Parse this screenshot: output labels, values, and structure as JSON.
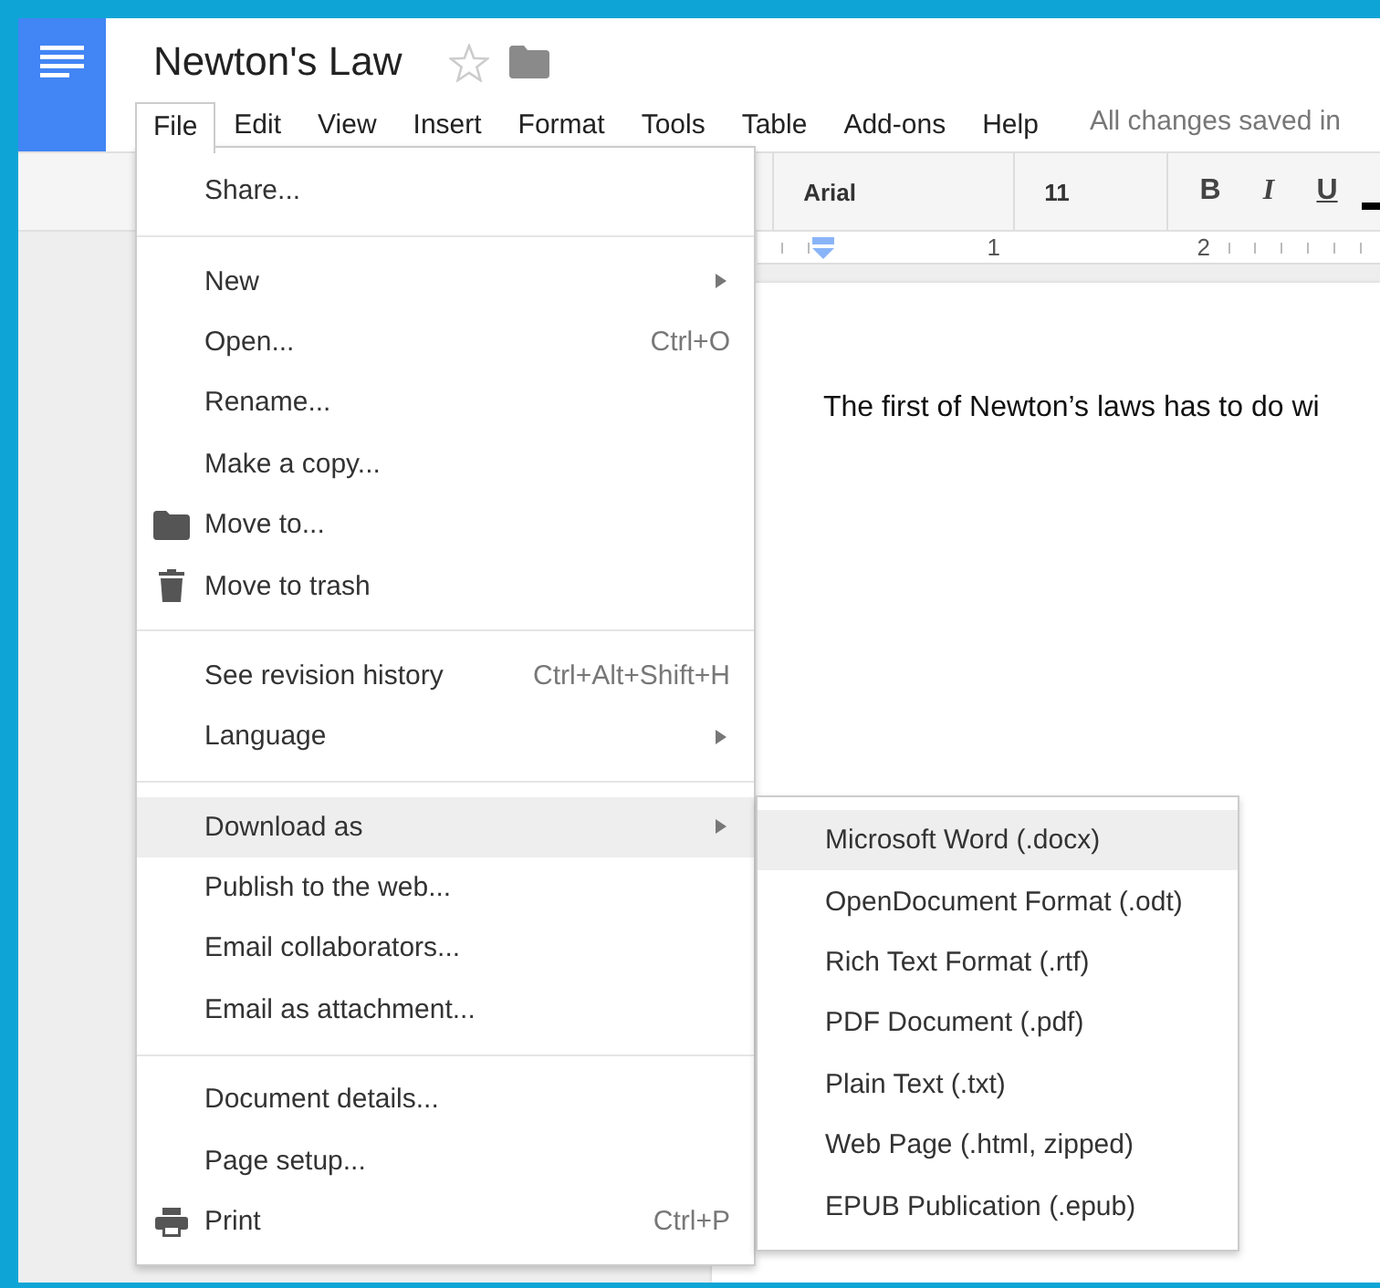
{
  "document": {
    "title": "Newton's Law"
  },
  "menubar": [
    {
      "label": "File",
      "selected": true
    },
    {
      "label": "Edit",
      "selected": false
    },
    {
      "label": "View",
      "selected": false
    },
    {
      "label": "Insert",
      "selected": false
    },
    {
      "label": "Format",
      "selected": false
    },
    {
      "label": "Tools",
      "selected": false
    },
    {
      "label": "Table",
      "selected": false
    },
    {
      "label": "Add-ons",
      "selected": false
    },
    {
      "label": "Help",
      "selected": false
    }
  ],
  "save_status": "All changes saved in",
  "toolbar": {
    "font": "Arial",
    "size": "11",
    "buttons": [
      "B",
      "I",
      "U"
    ]
  },
  "ruler": [
    "1",
    "2"
  ],
  "body_text": "The first of Newton’s laws has to do wi",
  "file_menu": {
    "groups": [
      [
        {
          "label": "Share...",
          "kind": "text",
          "selected": false
        }
      ],
      [
        {
          "label": "New",
          "kind": "submenu",
          "selected": false
        },
        {
          "label": "Open...",
          "kind": "text",
          "shortcut": "Ctrl+O",
          "selected": false
        },
        {
          "label": "Rename...",
          "kind": "text",
          "selected": false
        },
        {
          "label": "Make a copy...",
          "kind": "text",
          "selected": false
        },
        {
          "label": "Move to...",
          "kind": "folder",
          "selected": false
        },
        {
          "label": "Move to trash",
          "kind": "trash",
          "selected": false
        }
      ],
      [
        {
          "label": "See revision history",
          "kind": "text",
          "shortcut": "Ctrl+Alt+Shift+H",
          "selected": false
        },
        {
          "label": "Language",
          "kind": "submenu",
          "selected": false
        }
      ],
      [
        {
          "label": "Download as",
          "kind": "submenu",
          "selected": true
        },
        {
          "label": "Publish to the web...",
          "kind": "text",
          "selected": false
        },
        {
          "label": "Email collaborators...",
          "kind": "text",
          "selected": false
        },
        {
          "label": "Email as attachment...",
          "kind": "text",
          "selected": false
        }
      ],
      [
        {
          "label": "Document details...",
          "kind": "text",
          "selected": false
        },
        {
          "label": "Page setup...",
          "kind": "text",
          "selected": false
        },
        {
          "label": "Print",
          "kind": "printer",
          "shortcut": "Ctrl+P",
          "selected": false
        }
      ]
    ]
  },
  "download_submenu": [
    {
      "label": "Microsoft Word (.docx)",
      "selected": true
    },
    {
      "label": "OpenDocument Format (.odt)",
      "selected": false
    },
    {
      "label": "Rich Text Format (.rtf)",
      "selected": false
    },
    {
      "label": "PDF Document (.pdf)",
      "selected": false
    },
    {
      "label": "Plain Text (.txt)",
      "selected": false
    },
    {
      "label": "Web Page (.html, zipped)",
      "selected": false
    },
    {
      "label": "EPUB Publication (.epub)",
      "selected": false
    }
  ]
}
